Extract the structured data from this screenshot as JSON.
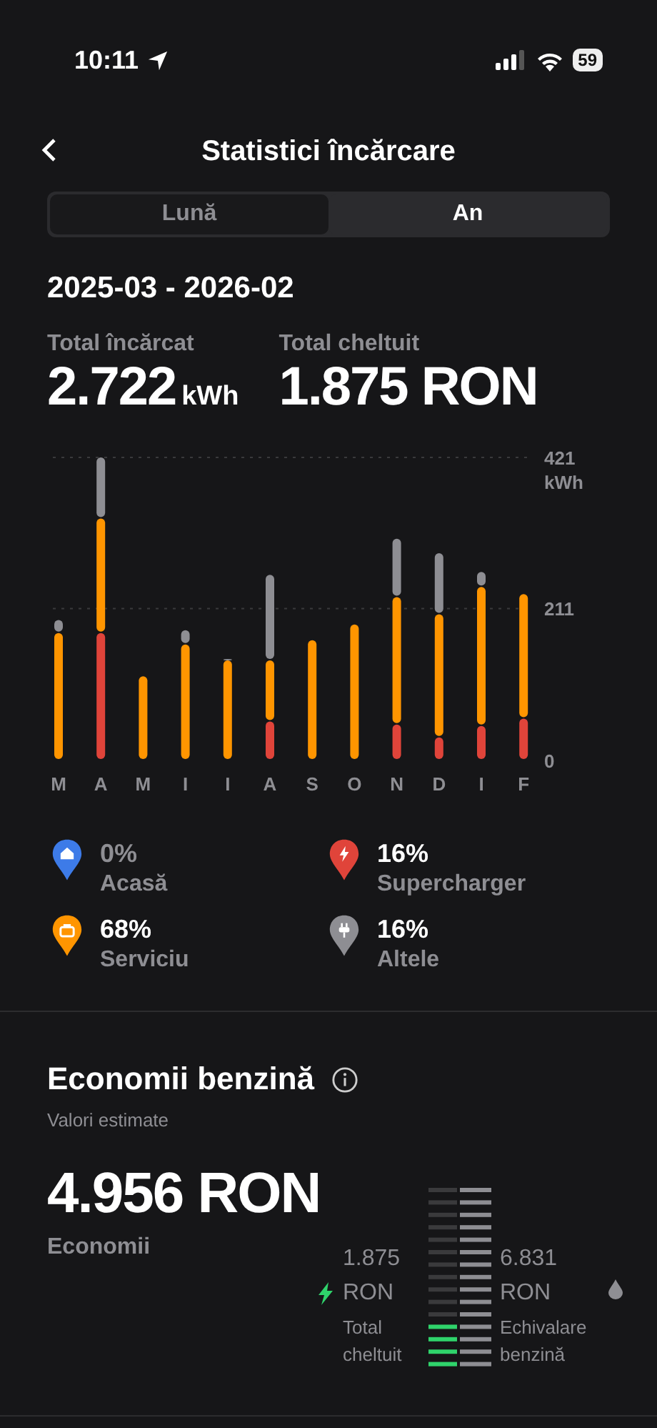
{
  "status_bar": {
    "time": "10:11",
    "battery": "59"
  },
  "header": {
    "title": "Statistici încărcare"
  },
  "tabs": [
    {
      "label": "Lună",
      "selected": false
    },
    {
      "label": "An",
      "selected": true
    }
  ],
  "period": "2025-03 - 2026-02",
  "totals": [
    {
      "label": "Total încărcat",
      "value": "2.722",
      "unit": "kWh"
    },
    {
      "label": "Total cheltuit",
      "value": "1.875 RON"
    }
  ],
  "chart_data": {
    "type": "bar",
    "stacked": true,
    "categories": [
      "M",
      "A",
      "M",
      "I",
      "I",
      "A",
      "S",
      "O",
      "N",
      "D",
      "I",
      "F"
    ],
    "ylabel": "kWh",
    "ylim": [
      0,
      421
    ],
    "yticks": [
      0,
      211,
      421
    ],
    "series": [
      {
        "name": "Acasă",
        "color": "#3d7be8",
        "values": [
          0,
          0,
          0,
          0,
          0,
          0,
          0,
          0,
          0,
          0,
          0,
          0
        ]
      },
      {
        "name": "Supercharger",
        "color": "#e0443a",
        "values": [
          0,
          177,
          0,
          0,
          0,
          54,
          0,
          0,
          50,
          32,
          48,
          58
        ]
      },
      {
        "name": "Serviciu",
        "color": "#ff9500",
        "values": [
          177,
          159,
          117,
          161,
          139,
          85,
          167,
          189,
          177,
          171,
          193,
          173
        ]
      },
      {
        "name": "Altele",
        "color": "#8e8e93",
        "values": [
          18,
          85,
          0,
          20,
          2,
          119,
          0,
          0,
          81,
          85,
          21,
          0
        ]
      }
    ]
  },
  "legend": [
    {
      "kind": "home",
      "percent": "0%",
      "dimmed": true
    },
    {
      "kind": "bolt",
      "percent": "16%",
      "dimmed": false
    },
    {
      "kind": "work",
      "percent": "68%",
      "dimmed": false
    },
    {
      "kind": "plug",
      "percent": "16%",
      "dimmed": false
    }
  ],
  "savings": {
    "title": "Economii benzină",
    "subtitle": "Valori estimate",
    "amount": "4.956 RON",
    "amount_label": "Economii",
    "left": {
      "value": "1.875",
      "unit": "RON",
      "label": "Total cheltuit"
    },
    "right": {
      "value": "6.831",
      "unit": "RON",
      "label": "Echivalare benzină"
    }
  }
}
